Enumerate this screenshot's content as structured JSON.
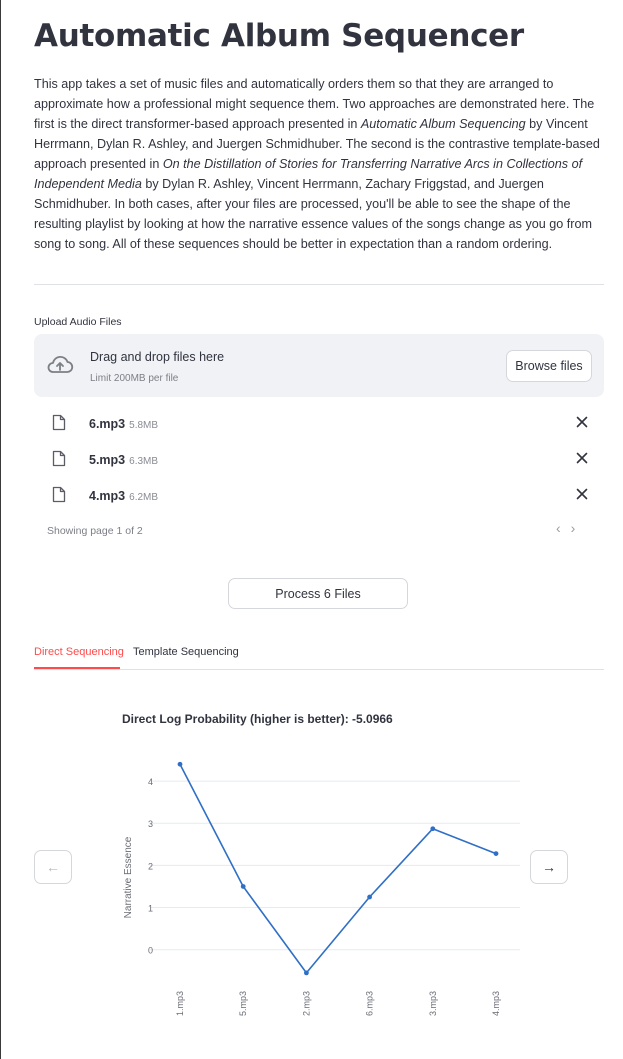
{
  "header": {
    "title": "Automatic Album Sequencer"
  },
  "intro": {
    "p1": "This app takes a set of music files and automatically orders them so that they are arranged to approximate how a professional might sequence them. Two approaches are demonstrated here. The first is the direct transformer-based approach presented in ",
    "paper1": "Automatic Album Sequencing",
    "p2": " by Vincent Herrmann, Dylan R. Ashley, and Juergen Schmidhuber. The second is the contrastive template-based approach presented in ",
    "paper2": "On the Distillation of Stories for Transferring Narrative Arcs in Collections of Independent Media",
    "p3": " by Dylan R. Ashley, Vincent Herrmann, Zachary Friggstad, and Juergen Schmidhuber. In both cases, after your files are processed, you'll be able to see the shape of the resulting playlist by looking at how the narrative essence values of the songs change as you go from song to song. All of these sequences should be better in expectation than a random ordering."
  },
  "uploader": {
    "label": "Upload Audio Files",
    "drop_title": "Drag and drop files here",
    "drop_subtitle": "Limit 200MB per file",
    "browse_label": "Browse files",
    "files": [
      {
        "name": "6.mp3",
        "size": "5.8MB"
      },
      {
        "name": "5.mp3",
        "size": "6.3MB"
      },
      {
        "name": "4.mp3",
        "size": "6.2MB"
      }
    ],
    "pager_text": "Showing page 1 of 2",
    "prev_glyph": "‹",
    "next_glyph": "›"
  },
  "process_button": "Process 6 Files",
  "tabs": [
    {
      "label": "Direct Sequencing",
      "active": true
    },
    {
      "label": "Template Sequencing",
      "active": false
    }
  ],
  "chart_nav": {
    "prev_glyph": "←",
    "next_glyph": "→"
  },
  "chart_data": {
    "type": "line",
    "title": "Direct Log Probability (higher is better): -5.0966",
    "xlabel": "",
    "ylabel": "Narrative Essence",
    "categories": [
      "1.mp3",
      "5.mp3",
      "2.mp3",
      "6.mp3",
      "3.mp3",
      "4.mp3"
    ],
    "series": [
      {
        "values": [
          4.4,
          1.5,
          -0.55,
          1.25,
          2.87,
          2.28
        ]
      }
    ],
    "yticks": [
      0,
      1,
      2,
      3,
      4
    ],
    "ylim": [
      -0.6,
      4.5
    ],
    "grid": true,
    "line_color": "#2f6fc6",
    "grid_color": "#e8eaee"
  }
}
